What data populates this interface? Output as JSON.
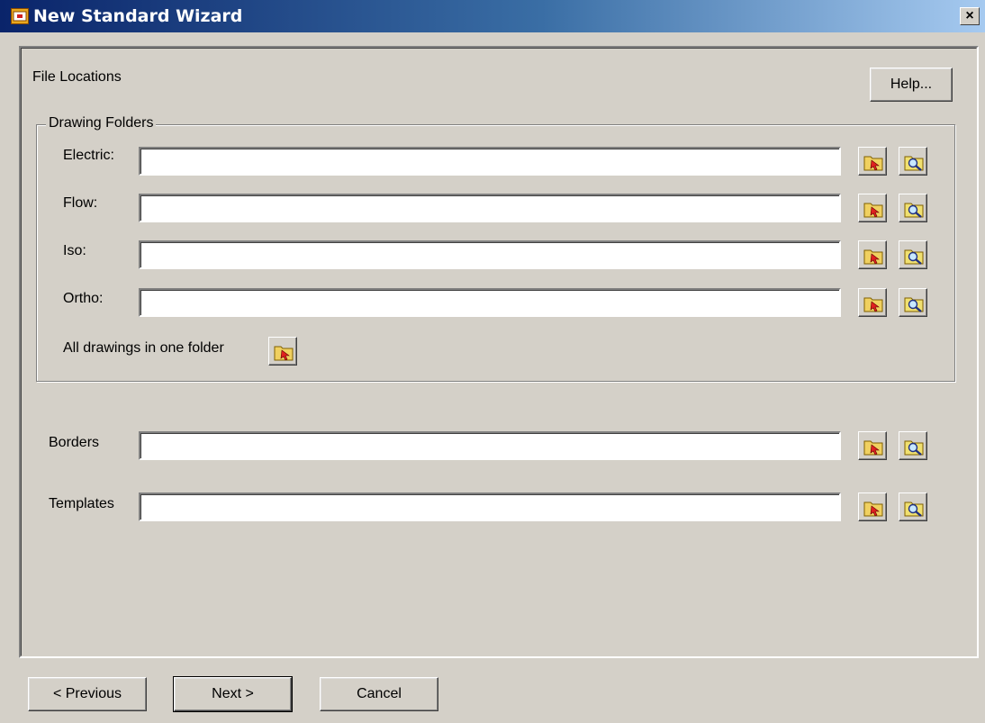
{
  "window": {
    "title": "New Standard Wizard",
    "close_label": "×"
  },
  "page": {
    "heading": "File Locations",
    "help_label": "Help..."
  },
  "drawing_folders": {
    "title": "Drawing Folders",
    "rows": [
      {
        "label": "Electric:",
        "value": ""
      },
      {
        "label": "Flow:",
        "value": ""
      },
      {
        "label": "Iso:",
        "value": ""
      },
      {
        "label": "Ortho:",
        "value": ""
      }
    ],
    "all_in_one_label": "All drawings in one folder"
  },
  "other_paths": [
    {
      "label": "Borders",
      "value": ""
    },
    {
      "label": "Templates",
      "value": ""
    }
  ],
  "icons": {
    "browse": "folder-arrow-icon",
    "search": "folder-search-icon"
  },
  "footer": {
    "previous_label": "< Previous",
    "next_label": "Next >",
    "cancel_label": "Cancel"
  },
  "colors": {
    "titlebar_start": "#0a246a",
    "titlebar_end": "#a6caf0",
    "face": "#d4d0c8"
  }
}
